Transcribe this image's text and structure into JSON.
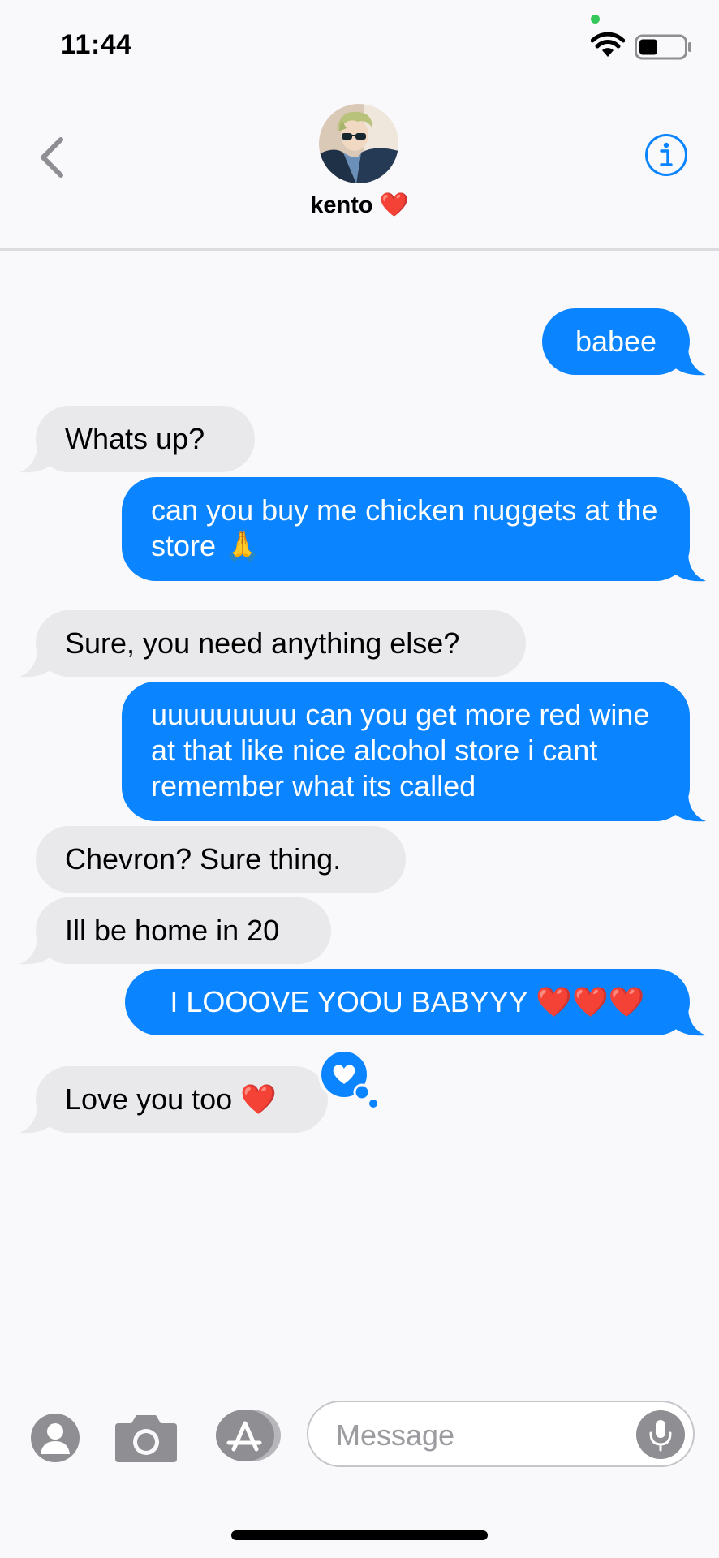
{
  "status_bar": {
    "time": "11:44",
    "battery_level": 0.4
  },
  "header": {
    "contact_name": "kento",
    "name_emoji": "❤️"
  },
  "messages": [
    {
      "direction": "out",
      "text": "babee"
    },
    {
      "direction": "in",
      "text": "Whats up?"
    },
    {
      "direction": "out",
      "text": "can you buy me chicken nuggets at the store 🙏"
    },
    {
      "direction": "in",
      "text": "Sure, you need anything else?"
    },
    {
      "direction": "out",
      "text": "uuuuuuuuu can you get more red wine at that like nice alcohol store i cant remember what its called"
    },
    {
      "direction": "in",
      "text": "Chevron? Sure thing."
    },
    {
      "direction": "in",
      "text": "Ill be home in 20"
    },
    {
      "direction": "out",
      "text": "I LOOOVE YOOU BABYYY ❤️❤️❤️"
    },
    {
      "direction": "in",
      "text": "Love you too ❤️",
      "reaction": "heart"
    }
  ],
  "input": {
    "placeholder": "Message"
  },
  "colors": {
    "accent": "#0a84ff",
    "incoming_bubble": "#e9e9ec",
    "background": "#f9f9fb"
  }
}
